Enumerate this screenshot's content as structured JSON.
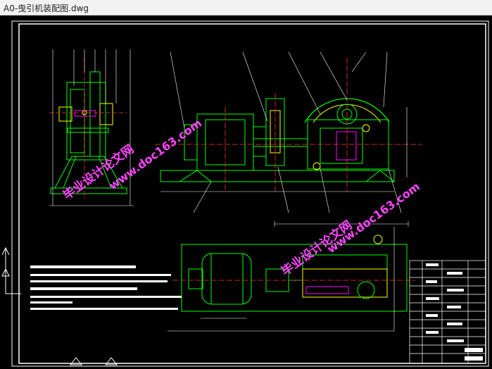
{
  "window": {
    "title": "A0-曳引机装配图.dwg"
  },
  "watermarks": {
    "brand_cn": "毕业设计论文网",
    "url": "www.doc163.com"
  },
  "colors": {
    "background": "#000000",
    "border": "#ffffff",
    "geometry": "#00ff00",
    "centerline": "#ff3333",
    "dimension": "#ffffff",
    "watermark": "#ff00ff",
    "accent_yellow": "#ffff00",
    "accent_cyan": "#00ffff"
  },
  "icons": {
    "ucs": "ucs-axis-icon"
  }
}
